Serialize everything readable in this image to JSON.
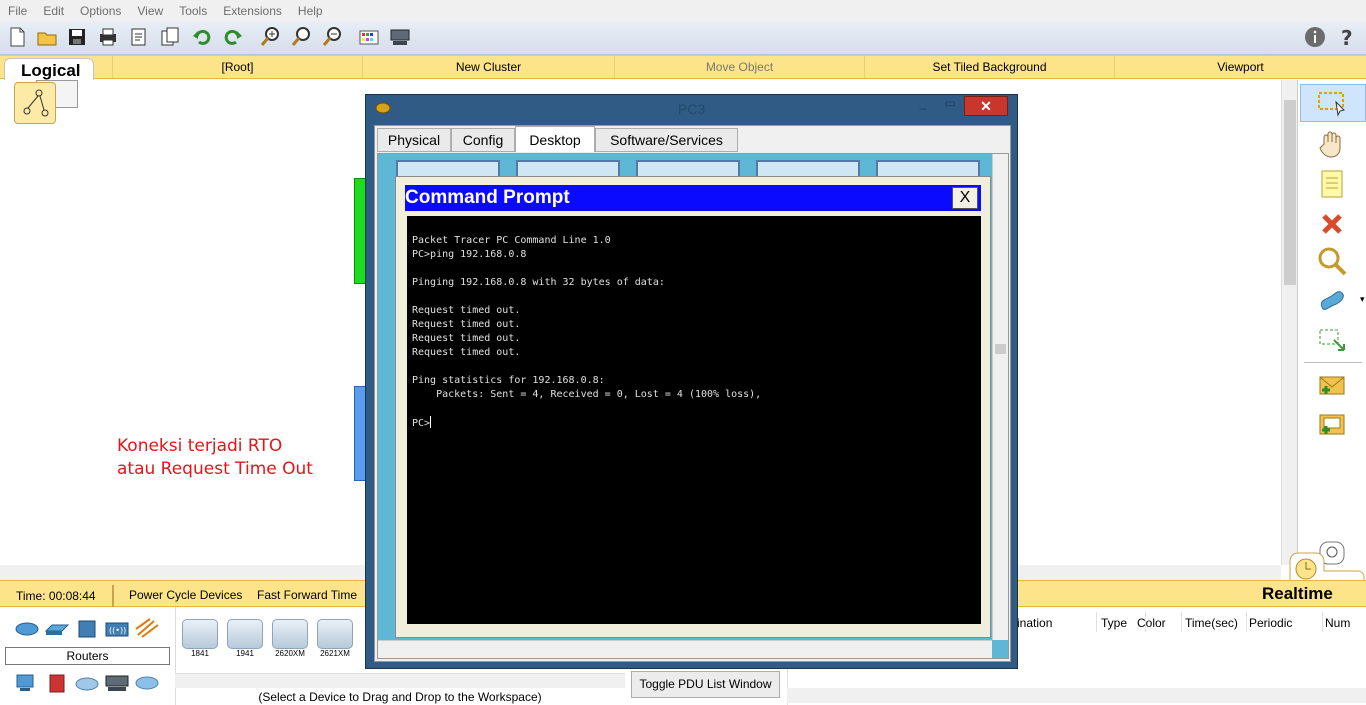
{
  "menu": [
    "File",
    "Edit",
    "Options",
    "View",
    "Tools",
    "Extensions",
    "Help"
  ],
  "logical_bar": {
    "tab": "Logical",
    "root": "[Root]",
    "new_cluster": "New Cluster",
    "move_object": "Move Object",
    "set_tiled_background": "Set Tiled Background",
    "viewport": "Viewport"
  },
  "annotation": {
    "line1": "Koneksi terjadi RTO",
    "line2": "atau Request Time Out"
  },
  "status": {
    "time": "Time: 00:08:44",
    "power_cycle": "Power Cycle Devices",
    "fast_forward": "Fast Forward Time",
    "realtime": "Realtime"
  },
  "devices": {
    "category": "Routers",
    "items": [
      "1841",
      "1941",
      "2620XM",
      "2621XM"
    ],
    "hint": "(Select a Device to Drag and Drop to the Workspace)"
  },
  "pdu": {
    "toggle_button": "Toggle PDU List Window",
    "headers": [
      "ination",
      "Type",
      "Color",
      "Time(sec)",
      "Periodic",
      "Num"
    ]
  },
  "pc_window": {
    "title": "PC3",
    "close": "✕",
    "tabs": [
      "Physical",
      "Config",
      "Desktop",
      "Software/Services"
    ],
    "active_tab": "Desktop"
  },
  "command_prompt": {
    "title": "Command Prompt",
    "close": "X",
    "output": "Packet Tracer PC Command Line 1.0\nPC>ping 192.168.0.8\n\nPinging 192.168.0.8 with 32 bytes of data:\n\nRequest timed out.\nRequest timed out.\nRequest timed out.\nRequest timed out.\n\nPing statistics for 192.168.0.8:\n    Packets: Sent = 4, Received = 0, Lost = 4 (100% loss),\n\n",
    "prompt": "PC>"
  },
  "colors": {
    "accent_yellow": "#fde48a",
    "window_blue": "#2f5b84",
    "cmd_title_blue": "#0a0aff",
    "annotation_red": "#e0161b"
  }
}
